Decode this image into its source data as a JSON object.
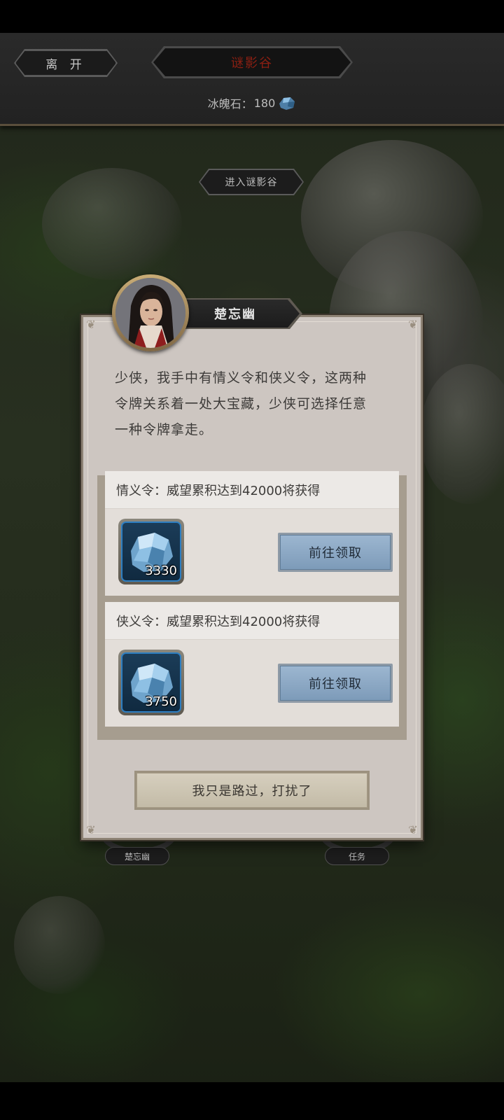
{
  "header": {
    "leave_label": "离 开",
    "location_title": "谜影谷",
    "currency_label": "冰魄石：",
    "currency_value": "180",
    "currency_icon": "ice-stone-icon"
  },
  "map": {
    "enter_label": "进入谜影谷",
    "npc_label": "楚忘幽",
    "quest_label": "任务"
  },
  "dialog": {
    "npc_name": "楚忘幽",
    "speech_lines": [
      "少侠，我手中有情义令和侠义令，这两种",
      "令牌关系着一处大宝藏，少侠可选择任意",
      "一种令牌拿走。"
    ],
    "rewards": [
      {
        "requirement": "情义令：威望累积达到42000将获得",
        "item_icon": "ice-stone-icon",
        "item_count": "3330",
        "button_label": "前往领取"
      },
      {
        "requirement": "侠义令：威望累积达到42000将获得",
        "item_icon": "ice-stone-icon",
        "item_count": "3750",
        "button_label": "前往领取"
      }
    ],
    "decline_label": "我只是路过，打扰了"
  }
}
